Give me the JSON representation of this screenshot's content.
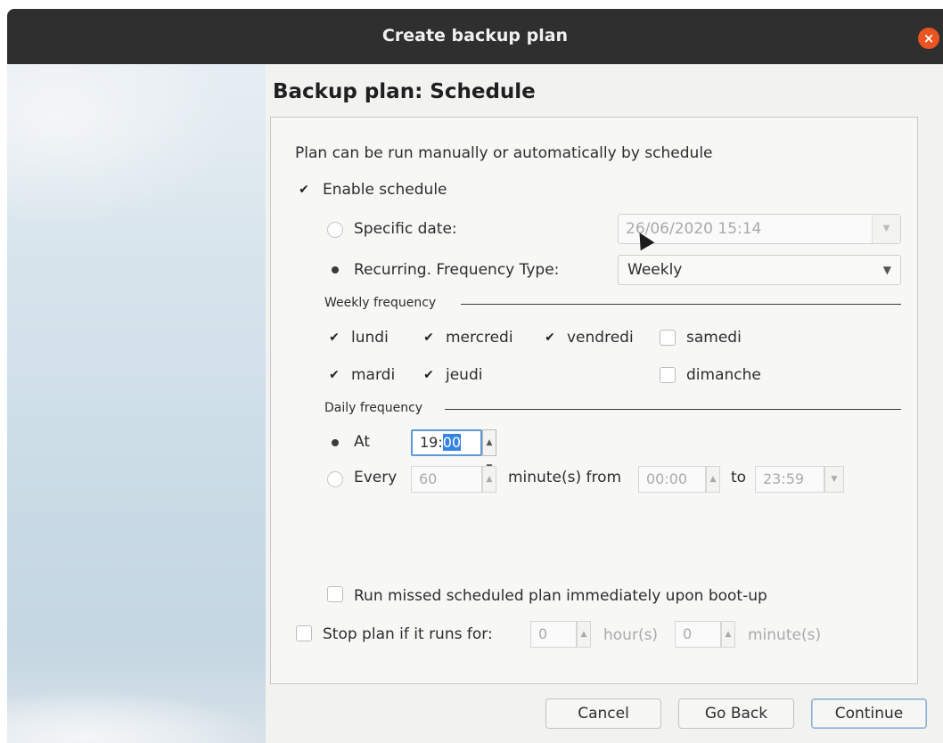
{
  "window": {
    "title": "Create backup plan"
  },
  "page": {
    "title": "Backup plan: Schedule"
  },
  "panel": {
    "intro": "Plan can be run manually or automatically by schedule",
    "enable_schedule": {
      "label": "Enable schedule",
      "checked": true
    },
    "specific_date": {
      "label": "Specific date:",
      "selected": false,
      "value": "26/06/2020 15:14"
    },
    "recurring": {
      "label": "Recurring. Frequency Type:",
      "selected": true,
      "value": "Weekly"
    },
    "weekly_frequency": {
      "heading": "Weekly frequency",
      "days": [
        {
          "label": "lundi",
          "checked": true
        },
        {
          "label": "mercredi",
          "checked": true
        },
        {
          "label": "vendredi",
          "checked": true
        },
        {
          "label": "samedi",
          "checked": false
        },
        {
          "label": "mardi",
          "checked": true
        },
        {
          "label": "jeudi",
          "checked": true
        },
        {
          "label": "dimanche",
          "checked": false
        }
      ]
    },
    "daily_frequency": {
      "heading": "Daily frequency",
      "at": {
        "label": "At",
        "selected": true,
        "hours": "19",
        "separator": ":",
        "minutes": "00"
      },
      "every": {
        "label": "Every",
        "selected": false,
        "value": "60",
        "unit_from": "minute(s) from",
        "from_value": "00:00",
        "to_label": "to",
        "to_value": "23:59"
      }
    },
    "run_missed": {
      "label": "Run missed scheduled plan immediately upon boot-up",
      "checked": false
    },
    "stop_plan": {
      "label": "Stop plan if it runs for:",
      "checked": false,
      "hours_value": "0",
      "hours_label": "hour(s)",
      "minutes_value": "0",
      "minutes_label": "minute(s)"
    }
  },
  "buttons": {
    "cancel": "Cancel",
    "go_back": "Go Back",
    "continue": "Continue"
  },
  "icons": {
    "close": "close-icon",
    "check": "✔",
    "dropdown": "chevron-down-icon"
  },
  "colors": {
    "titlebar": "#2f2f2f",
    "close": "#e95420",
    "selection": "#3584e4"
  }
}
